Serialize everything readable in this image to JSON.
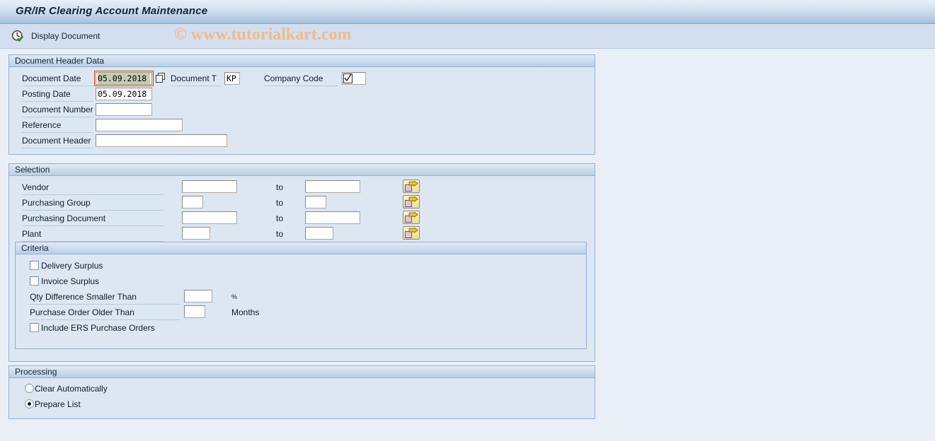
{
  "window": {
    "title": "GR/IR Clearing Account Maintenance"
  },
  "watermark": {
    "text": "© www.tutorialkart.com",
    "color": "#edbb8e"
  },
  "toolbar": {
    "display_document_label": "Display Document",
    "display_document_icon": "display-document-icon"
  },
  "document_header": {
    "group_title": "Document Header Data",
    "fields": {
      "document_date_label": "Document Date",
      "document_date_value": "05.09.2018",
      "document_type_label": "Document T",
      "document_type_value": "KP",
      "company_code_label": "Company Code",
      "company_code_value": "",
      "posting_date_label": "Posting Date",
      "posting_date_value": "05.09.2018",
      "document_number_label": "Document Number",
      "document_number_value": "",
      "reference_label": "Reference",
      "reference_value": "",
      "document_header_label": "Document Header",
      "document_header_value": ""
    }
  },
  "selection": {
    "group_title": "Selection",
    "to_label": "to",
    "rows": [
      {
        "label": "Vendor",
        "from": "",
        "to": ""
      },
      {
        "label": "Purchasing Group",
        "from": "",
        "to": ""
      },
      {
        "label": "Purchasing Document",
        "from": "",
        "to": ""
      },
      {
        "label": "Plant",
        "from": "",
        "to": ""
      }
    ],
    "multi_select_icon": "multiple-selection-arrow-icon"
  },
  "criteria": {
    "group_title": "Criteria",
    "delivery_surplus_label": "Delivery Surplus",
    "delivery_surplus_checked": false,
    "invoice_surplus_label": "Invoice Surplus",
    "invoice_surplus_checked": false,
    "qty_difference_label": "Qty Difference Smaller Than",
    "qty_difference_value": "",
    "qty_difference_unit": "%",
    "po_older_label": "Purchase Order Older Than",
    "po_older_value": "",
    "po_older_unit": "Months",
    "include_ers_label": "Include ERS Purchase Orders",
    "include_ers_checked": false
  },
  "processing": {
    "group_title": "Processing",
    "options": [
      {
        "label": "Clear Automatically",
        "selected": false
      },
      {
        "label": "Prepare List",
        "selected": true
      }
    ]
  },
  "colors": {
    "page_background": "#e9eff7",
    "group_background": "#dde7f2",
    "group_border": "#93b0d3",
    "toolbar_background": "#d3dfee",
    "focus_border": "#e03b28"
  }
}
